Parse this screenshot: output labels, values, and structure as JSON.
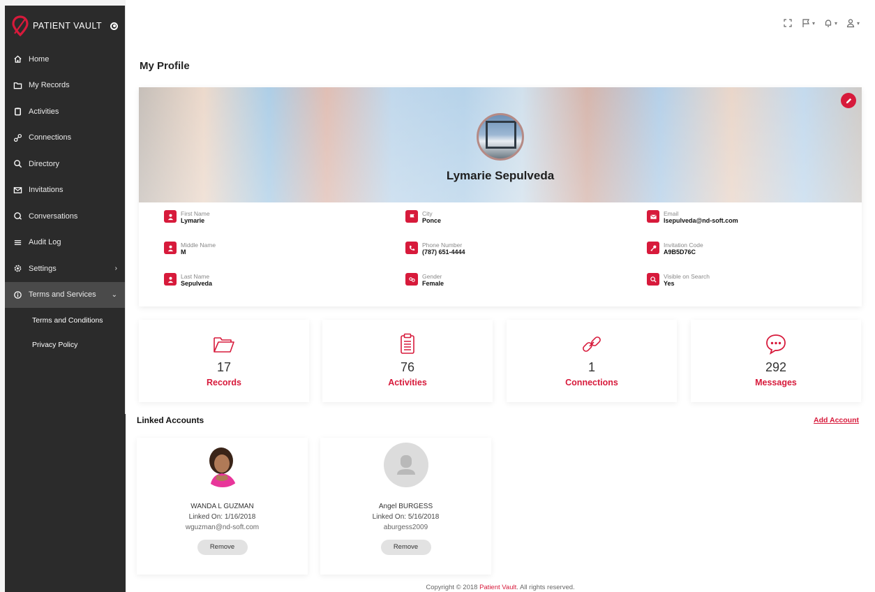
{
  "brand": {
    "name": "PATIENT VAULT",
    "accent": "#d71a3b"
  },
  "sidebar": {
    "items": [
      {
        "label": "Home",
        "icon": "home-icon"
      },
      {
        "label": "My Records",
        "icon": "folder-icon"
      },
      {
        "label": "Activities",
        "icon": "clipboard-icon"
      },
      {
        "label": "Connections",
        "icon": "link-icon"
      },
      {
        "label": "Directory",
        "icon": "search-icon"
      },
      {
        "label": "Invitations",
        "icon": "envelope-icon"
      },
      {
        "label": "Conversations",
        "icon": "chat-icon"
      },
      {
        "label": "Audit Log",
        "icon": "menu-icon"
      },
      {
        "label": "Settings",
        "icon": "gear-icon"
      },
      {
        "label": "Terms and Services",
        "icon": "info-icon"
      }
    ],
    "sub_items": [
      {
        "label": "Terms and Conditions"
      },
      {
        "label": "Privacy Policy"
      }
    ]
  },
  "page": {
    "title": "My Profile"
  },
  "profile": {
    "name": "Lymarie Sepulveda",
    "fields": [
      {
        "label": "First Name",
        "value": "Lymarie",
        "icon": "user-icon"
      },
      {
        "label": "Middle Name",
        "value": "M",
        "icon": "user-icon"
      },
      {
        "label": "Last Name",
        "value": "Sepulveda",
        "icon": "user-icon"
      },
      {
        "label": "City",
        "value": "Ponce",
        "icon": "flag-icon"
      },
      {
        "label": "Phone Number",
        "value": "(787) 651-4444",
        "icon": "phone-icon"
      },
      {
        "label": "Gender",
        "value": "Female",
        "icon": "gender-icon"
      },
      {
        "label": "Email",
        "value": "lsepulveda@nd-soft.com",
        "icon": "envelope-icon"
      },
      {
        "label": "Invitation Code",
        "value": "A9B5D76C",
        "icon": "key-icon"
      },
      {
        "label": "Visible on Search",
        "value": "Yes",
        "icon": "search-icon"
      }
    ]
  },
  "stats": [
    {
      "value": "17",
      "label": "Records",
      "icon": "folder-icon"
    },
    {
      "value": "76",
      "label": "Activities",
      "icon": "clipboard-icon"
    },
    {
      "value": "1",
      "label": "Connections",
      "icon": "link-icon"
    },
    {
      "value": "292",
      "label": "Messages",
      "icon": "chat-bubble-icon"
    }
  ],
  "linked": {
    "title": "Linked Accounts",
    "add_label": "Add Account",
    "accounts": [
      {
        "name": "WANDA L GUZMAN",
        "linked_on": "Linked On: 1/16/2018",
        "contact": "wguzman@nd-soft.com",
        "remove_label": "Remove"
      },
      {
        "name": "Angel BURGESS",
        "linked_on": "Linked On: 5/16/2018",
        "contact": "aburgess2009",
        "remove_label": "Remove"
      }
    ]
  },
  "footer": {
    "prefix": "Copyright © 2018 ",
    "brand": "Patient Vault",
    "suffix": ". All rights reserved."
  }
}
